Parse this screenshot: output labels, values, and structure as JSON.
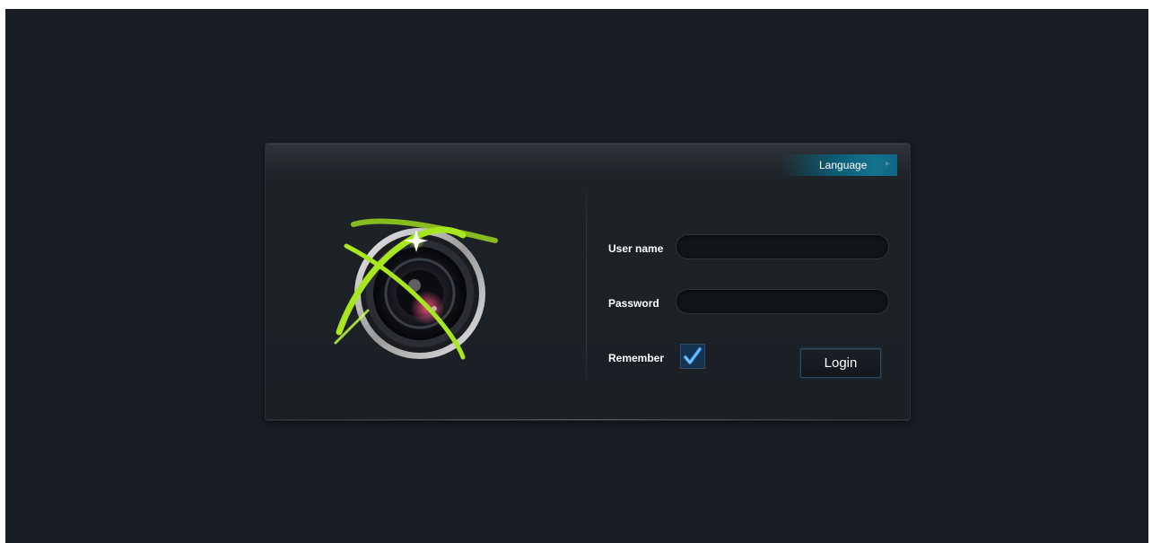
{
  "header": {
    "language_label": "Language"
  },
  "form": {
    "username": {
      "label": "User name",
      "value": "",
      "placeholder": ""
    },
    "password": {
      "label": "Password",
      "value": "",
      "placeholder": ""
    },
    "remember": {
      "label": "Remember",
      "checked": true
    },
    "login_label": "Login"
  },
  "icons": {
    "logo": "camera-lens-icon",
    "language_arrow": "chevron-right-icon",
    "checkbox": "checkmark-icon"
  },
  "colors": {
    "background": "#181d23",
    "panel": "#1d2227",
    "accent": "#13728e",
    "logo_ring": "#9ad61e",
    "checkbox_fill": "#15324e",
    "check": "#3d9be9"
  }
}
